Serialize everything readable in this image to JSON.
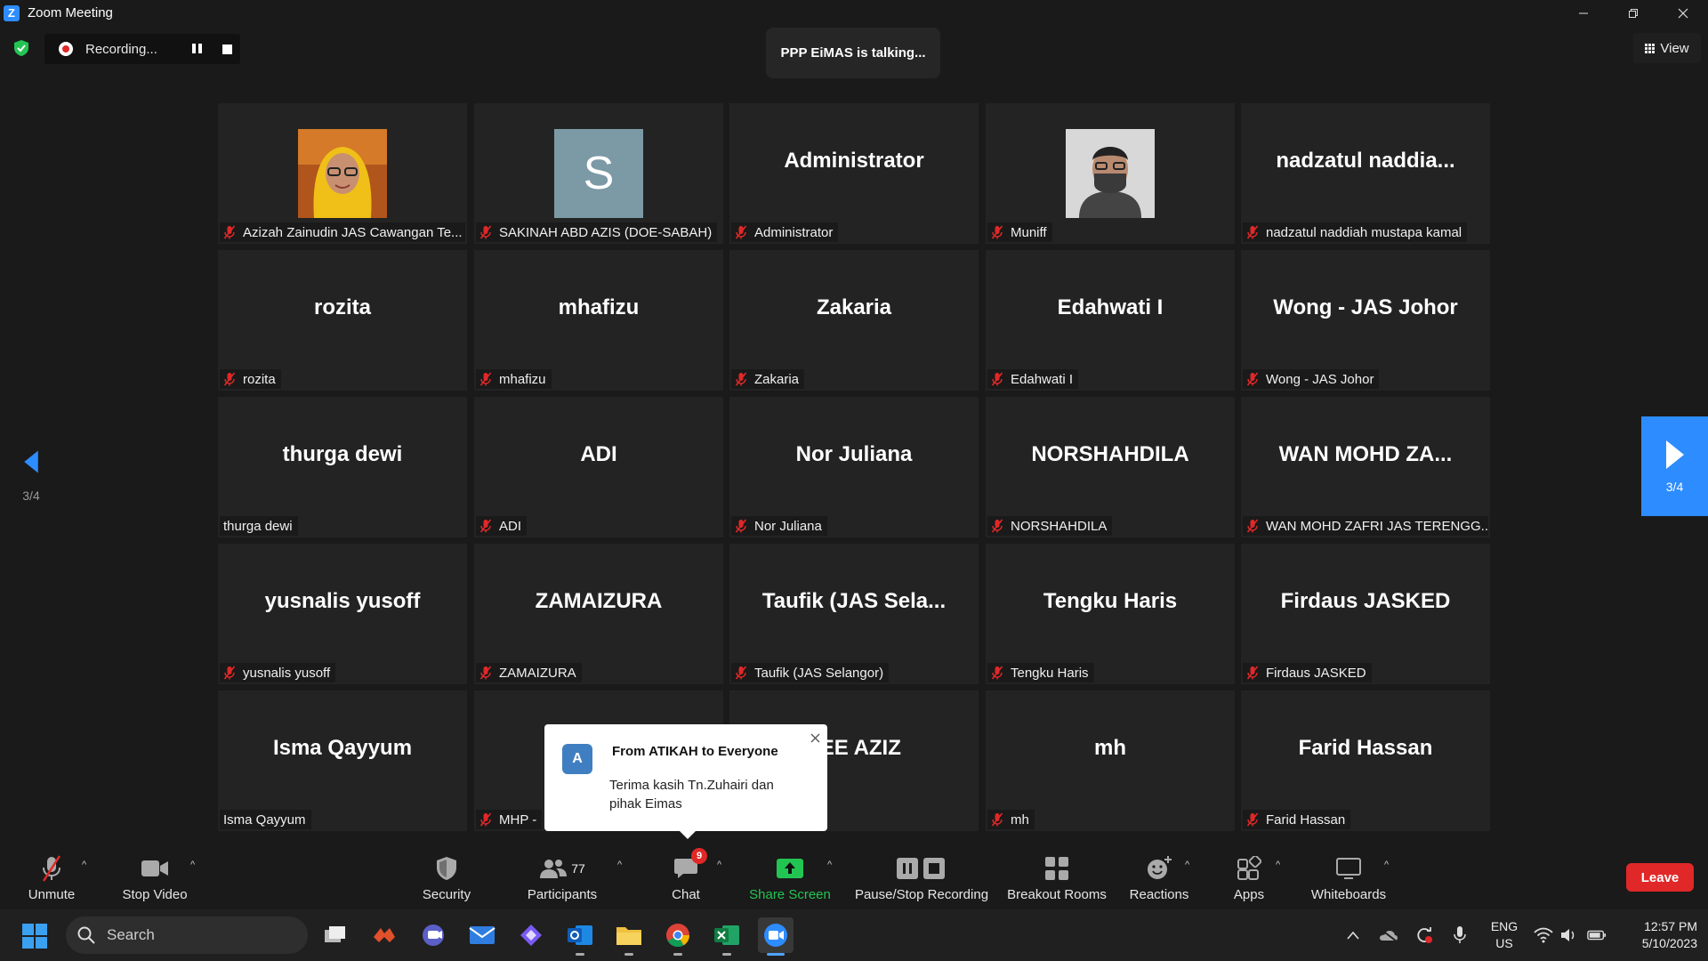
{
  "window": {
    "title": "Zoom Meeting"
  },
  "recording": {
    "status": "Recording..."
  },
  "speaker": {
    "talking": "PPP EiMAS is talking..."
  },
  "view": {
    "label": "View"
  },
  "tiles": [
    {
      "display": "",
      "label": "Azizah Zainudin JAS Cawangan Te...",
      "muted": true,
      "avatar": "photo-woman-yellow-hijab"
    },
    {
      "display": "S",
      "label": "SAKINAH ABD AZIS (DOE-SABAH)",
      "muted": true,
      "avatar": "letter"
    },
    {
      "display": "Administrator",
      "label": "Administrator",
      "muted": true
    },
    {
      "display": "",
      "label": "Muniff",
      "muted": true,
      "avatar": "photo-man-mask"
    },
    {
      "display": "nadzatul  naddia...",
      "label": "nadzatul naddiah mustapa kamal",
      "muted": true
    },
    {
      "display": "rozita",
      "label": "rozita",
      "muted": true
    },
    {
      "display": "mhafizu",
      "label": "mhafizu",
      "muted": true
    },
    {
      "display": "Zakaria",
      "label": "Zakaria",
      "muted": true
    },
    {
      "display": "Edahwati I",
      "label": "Edahwati I",
      "muted": true
    },
    {
      "display": "Wong - JAS Johor",
      "label": "Wong - JAS Johor",
      "muted": true
    },
    {
      "display": "thurga dewi",
      "label": "thurga dewi",
      "muted": false
    },
    {
      "display": "ADI",
      "label": "ADI",
      "muted": true
    },
    {
      "display": "Nor Juliana",
      "label": "Nor Juliana",
      "muted": true
    },
    {
      "display": "NORSHAHDILA",
      "label": "NORSHAHDILA",
      "muted": true
    },
    {
      "display": "WAN  MOHD  ZA...",
      "label": "WAN MOHD ZAFRI JAS TERENGG...",
      "muted": true
    },
    {
      "display": "yusnalis yusoff",
      "label": "yusnalis yusoff",
      "muted": true
    },
    {
      "display": "ZAMAIZURA",
      "label": "ZAMAIZURA",
      "muted": true
    },
    {
      "display": "Taufik  (JAS  Sela...",
      "label": "Taufik (JAS Selangor)",
      "muted": true
    },
    {
      "display": "Tengku Haris",
      "label": "Tengku Haris",
      "muted": true
    },
    {
      "display": "Firdaus JASKED",
      "label": "Firdaus JASKED",
      "muted": true
    },
    {
      "display": "Isma Qayyum",
      "label": "Isma Qayyum",
      "muted": false
    },
    {
      "display": "MH",
      "label": "MHP -",
      "muted": true
    },
    {
      "display": "ZEE AZIZ",
      "label": "",
      "muted": false
    },
    {
      "display": "mh",
      "label": "mh",
      "muted": true
    },
    {
      "display": "Farid Hassan",
      "label": "Farid Hassan",
      "muted": true
    }
  ],
  "pagination": {
    "left_page": "3/4",
    "right_page": "3/4"
  },
  "chat_popup": {
    "avatar_letter": "A",
    "from": "From ATIKAH to Everyone",
    "message": "Terima kasih Tn.Zuhairi dan pihak Eimas"
  },
  "toolbar": {
    "unmute": "Unmute",
    "stop_video": "Stop Video",
    "security": "Security",
    "participants": "Participants",
    "participants_count": "77",
    "chat": "Chat",
    "chat_badge": "9",
    "share_screen": "Share Screen",
    "pause_stop_recording": "Pause/Stop Recording",
    "breakout_rooms": "Breakout Rooms",
    "reactions": "Reactions",
    "apps": "Apps",
    "whiteboards": "Whiteboards",
    "leave": "Leave"
  },
  "taskbar": {
    "search": "Search",
    "apps": [
      "task-view-icon",
      "app-red-icon",
      "teams-icon",
      "mail-icon",
      "copilot-icon",
      "outlook-icon",
      "file-explorer-icon",
      "chrome-icon",
      "excel-icon",
      "zoom-icon"
    ],
    "lang_line1": "ENG",
    "lang_line2": "US",
    "time": "12:57 PM",
    "date": "5/10/2023"
  },
  "colors": {
    "accent": "#2d8cff",
    "leave": "#e02828",
    "share": "#23c552",
    "tile_bg": "#232323"
  }
}
